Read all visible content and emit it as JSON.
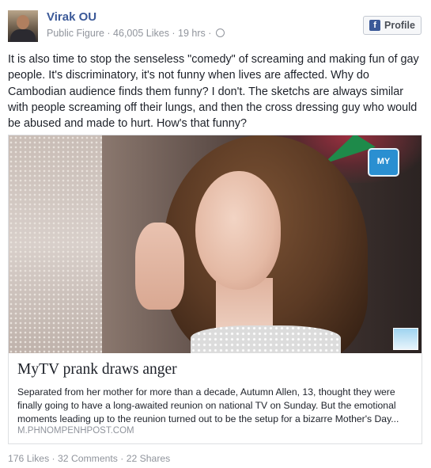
{
  "post": {
    "author_name": "Virak OU",
    "meta": "Public Figure · 46,005 Likes · 19 hrs ·",
    "globe_icon": "globe-icon",
    "profile_button_label": "Profile",
    "profile_button_icon": "facebook-f-icon",
    "text": "It is also time to stop the senseless \"comedy\" of screaming and making fun of gay people. It's discriminatory, it's not funny when lives are affected. Why do Cambodian audience finds them funny? I don't. The sketchs are always similar with people screaming off their lungs, and then the cross dressing guy who would be abused and made to hurt. How's that funny?"
  },
  "link_card": {
    "image_logo_text": "MY",
    "title": "MyTV prank draws anger",
    "description": "Separated from her mother for more than a decade, Autumn Allen, 13, thought they were finally going to have a long-awaited reunion on national TV on Sunday. But the emotional moments leading up to the reunion turned out to be the setup for a bizarre Mother's Day...",
    "domain": "M.PHNOMPENHPOST.COM"
  },
  "stats": {
    "text": "176 Likes · 32 Comments · 22 Shares"
  },
  "colors": {
    "link_blue": "#3b5998",
    "meta_gray": "#90949c",
    "text": "#1d2129",
    "border": "#dddfe2"
  }
}
